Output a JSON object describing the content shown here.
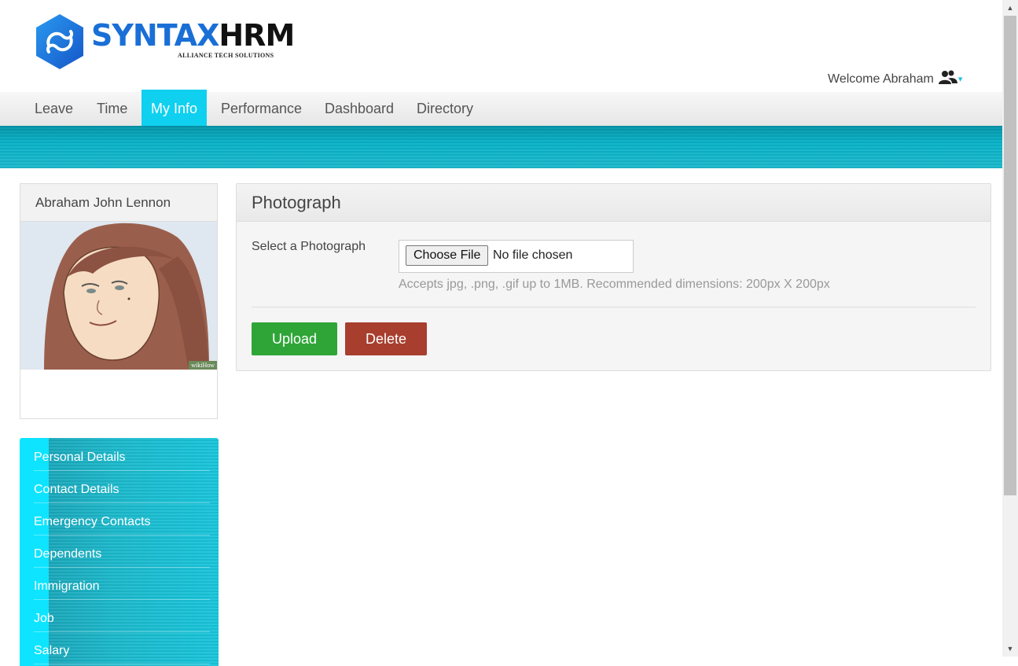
{
  "brand": {
    "name_part1": "SYNTAX",
    "name_part2": "HRM",
    "tagline": "ALLIANCE TECH SOLUTIONS"
  },
  "header": {
    "welcome_text": "Welcome Abraham",
    "user_icon": "users-icon",
    "caret": "▾"
  },
  "nav": {
    "items": [
      "Leave",
      "Time",
      "My Info",
      "Performance",
      "Dashboard",
      "Directory"
    ],
    "active": "My Info"
  },
  "profile": {
    "name": "Abraham John Lennon",
    "photo_watermark": "wikiHow"
  },
  "side_menu": {
    "items": [
      "Personal Details",
      "Contact Details",
      "Emergency Contacts",
      "Dependents",
      "Immigration",
      "Job",
      "Salary"
    ]
  },
  "photograph_panel": {
    "title": "Photograph",
    "field_label": "Select a Photograph",
    "choose_button": "Choose File",
    "file_status": "No file chosen",
    "hint": "Accepts jpg, .png, .gif up to 1MB. Recommended dimensions: 200px X 200px",
    "upload_label": "Upload",
    "delete_label": "Delete"
  },
  "colors": {
    "accent": "#10d0f0",
    "banner": "#0fb3c8",
    "upload": "#2fa538",
    "delete": "#a83e2e",
    "brand_blue": "#1a6fd6"
  },
  "scrollbar": {
    "up": "▲",
    "down": "▼"
  }
}
